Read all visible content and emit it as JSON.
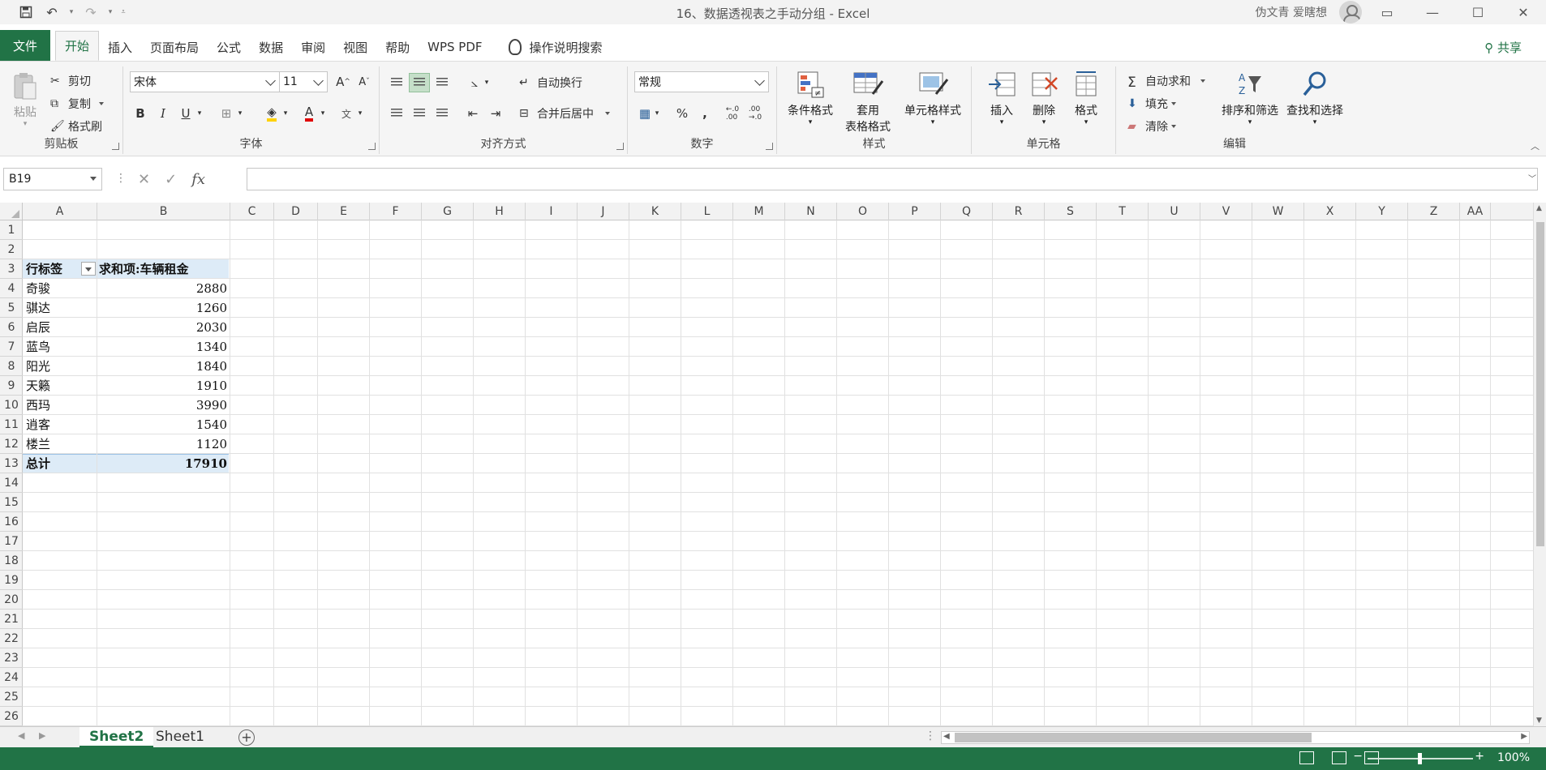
{
  "window": {
    "title": "16、数据透视表之手动分组  -  Excel",
    "user": "伪文青 爱瞎想"
  },
  "tabs": [
    "文件",
    "开始",
    "插入",
    "页面布局",
    "公式",
    "数据",
    "审阅",
    "视图",
    "帮助",
    "WPS PDF"
  ],
  "tell_me": "操作说明搜索",
  "share": "共享",
  "ribbon": {
    "clipboard": {
      "paste": "粘贴",
      "cut": "剪切",
      "copy": "复制",
      "painter": "格式刷",
      "label": "剪贴板"
    },
    "font": {
      "name": "宋体",
      "size": "11",
      "label": "字体",
      "bold": "B",
      "italic": "I",
      "underline": "U"
    },
    "alignment": {
      "wrap": "自动换行",
      "merge": "合并后居中",
      "label": "对齐方式"
    },
    "number": {
      "format": "常规",
      "label": "数字"
    },
    "styles": {
      "conditional": "条件格式",
      "table1": "套用",
      "table2": "表格格式",
      "cell": "单元格样式",
      "label": "样式"
    },
    "cells": {
      "insert": "插入",
      "delete": "删除",
      "format": "格式",
      "label": "单元格"
    },
    "editing": {
      "autosum": "自动求和",
      "fill": "填充",
      "clear": "清除",
      "sort": "排序和筛选",
      "find": "查找和选择",
      "label": "编辑"
    }
  },
  "namebox": "B19",
  "columns": [
    "A",
    "B",
    "C",
    "D",
    "E",
    "F",
    "G",
    "H",
    "I",
    "J",
    "K",
    "L",
    "M",
    "N",
    "O",
    "P",
    "Q",
    "R",
    "S",
    "T",
    "U",
    "V",
    "W",
    "X",
    "Y",
    "Z",
    "AA"
  ],
  "rows": [
    "1",
    "2",
    "3",
    "4",
    "5",
    "6",
    "7",
    "8",
    "9",
    "10",
    "11",
    "12",
    "13",
    "14",
    "15",
    "16",
    "17",
    "18",
    "19",
    "20",
    "21",
    "22",
    "23",
    "24",
    "25",
    "26"
  ],
  "pivot": {
    "header_label": "行标签",
    "header_value": "求和项:车辆租金",
    "items": [
      {
        "label": "奇骏",
        "value": "2880"
      },
      {
        "label": "骐达",
        "value": "1260"
      },
      {
        "label": "启辰",
        "value": "2030"
      },
      {
        "label": "蓝鸟",
        "value": "1340"
      },
      {
        "label": "阳光",
        "value": "1840"
      },
      {
        "label": "天籁",
        "value": "1910"
      },
      {
        "label": "西玛",
        "value": "3990"
      },
      {
        "label": "逍客",
        "value": "1540"
      },
      {
        "label": "楼兰",
        "value": "1120"
      }
    ],
    "total_label": "总计",
    "total_value": "17910"
  },
  "sheets": [
    "Sheet2",
    "Sheet1"
  ],
  "zoom": "100%",
  "colors": {
    "accent": "#217346",
    "pivot_header": "#ddebf7"
  }
}
